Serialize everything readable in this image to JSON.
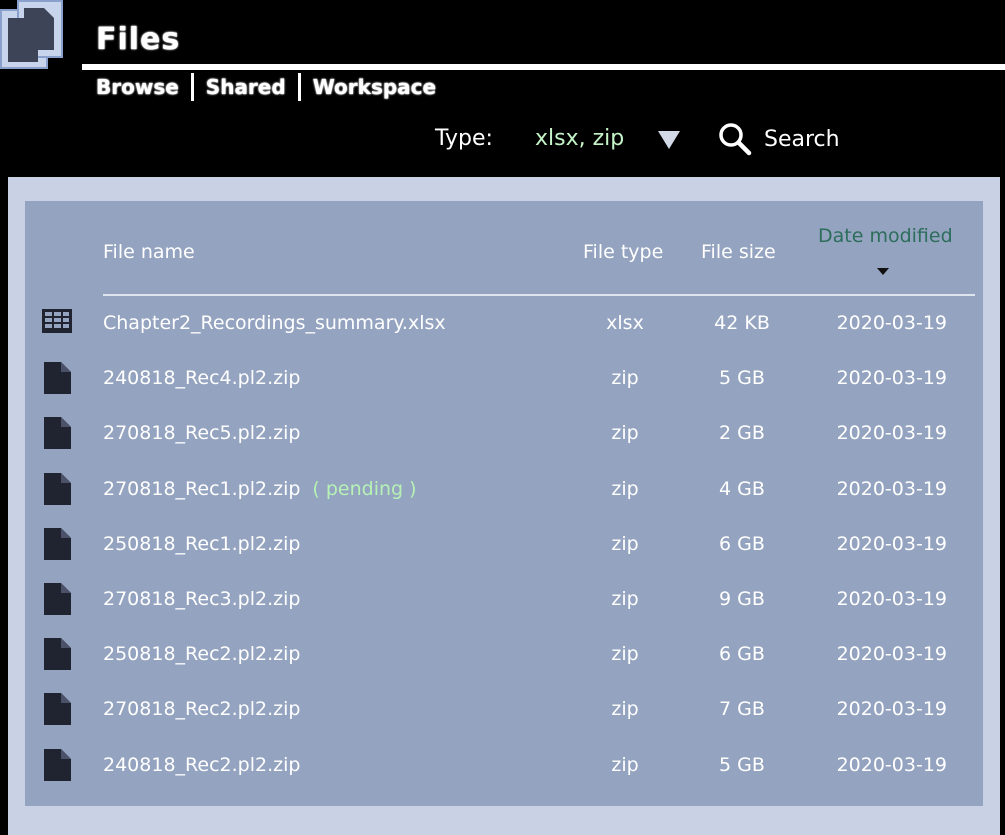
{
  "header": {
    "title": "Files",
    "nav": [
      "Browse",
      "Shared",
      "Workspace"
    ]
  },
  "filter": {
    "type_label": "Type:",
    "type_value": "xlsx, zip",
    "search_label": "Search"
  },
  "table": {
    "columns": {
      "name": "File name",
      "type": "File type",
      "size": "File size",
      "date": "Date modified"
    },
    "sort": {
      "column": "date",
      "direction": "descending"
    },
    "rows": [
      {
        "icon": "spreadsheet-icon",
        "name": "Chapter2_Recordings_summary.xlsx",
        "status": "",
        "type": "xlsx",
        "size": "42 KB",
        "date": "2020-03-19"
      },
      {
        "icon": "file-icon",
        "name": "240818_Rec4.pl2.zip",
        "status": "",
        "type": "zip",
        "size": "5 GB",
        "date": "2020-03-19"
      },
      {
        "icon": "file-icon",
        "name": "270818_Rec5.pl2.zip",
        "status": "",
        "type": "zip",
        "size": "2 GB",
        "date": "2020-03-19"
      },
      {
        "icon": "file-icon",
        "name": "270818_Rec1.pl2.zip",
        "status": "( pending )",
        "type": "zip",
        "size": "4 GB",
        "date": "2020-03-19"
      },
      {
        "icon": "file-icon",
        "name": "250818_Rec1.pl2.zip",
        "status": "",
        "type": "zip",
        "size": "6 GB",
        "date": "2020-03-19"
      },
      {
        "icon": "file-icon",
        "name": "270818_Rec3.pl2.zip",
        "status": "",
        "type": "zip",
        "size": "9 GB",
        "date": "2020-03-19"
      },
      {
        "icon": "file-icon",
        "name": "250818_Rec2.pl2.zip",
        "status": "",
        "type": "zip",
        "size": "6 GB",
        "date": "2020-03-19"
      },
      {
        "icon": "file-icon",
        "name": "270818_Rec2.pl2.zip",
        "status": "",
        "type": "zip",
        "size": "7 GB",
        "date": "2020-03-19"
      },
      {
        "icon": "file-icon",
        "name": "240818_Rec2.pl2.zip",
        "status": "",
        "type": "zip",
        "size": "5 GB",
        "date": "2020-03-19"
      }
    ]
  },
  "colors": {
    "background": "#000000",
    "panel": "#c8d2e4",
    "table": "#94a3bf",
    "accent_green": "#c4f4c8",
    "sorted_header": "#2c6d5c",
    "pending": "#b6f2b6"
  }
}
